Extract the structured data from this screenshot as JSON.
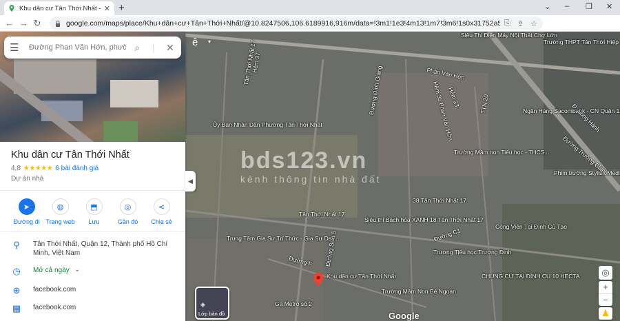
{
  "browser": {
    "tab_title": "Khu dân cư Tân Thới Nhất - Goo",
    "url": "google.com/maps/place/Khu+dân+cư+Tân+Thới+Nhất/@10.8247506,106.6189916,916m/data=!3m1!1e3!4m13!1m7!3m6!1s0x31752a580ce47c45:0x33...",
    "profile_initial": "n",
    "ext_badge": "20"
  },
  "search": {
    "placeholder": "Đường Phan Văn Hớn, phường Tân Thới Nhất"
  },
  "place": {
    "name": "Khu dân cư Tân Thới Nhất",
    "rating": "4,8",
    "stars": "★★★★★",
    "reviews": "6 bài đánh giá",
    "category": "Dự án nhà"
  },
  "actions": [
    {
      "label": "Đường đi",
      "icon": "directions-icon"
    },
    {
      "label": "Trang web",
      "icon": "globe-icon"
    },
    {
      "label": "Lưu",
      "icon": "bookmark-icon"
    },
    {
      "label": "Gần đó",
      "icon": "nearby-icon"
    },
    {
      "label": "Chia sẻ",
      "icon": "share-icon"
    }
  ],
  "info": {
    "address": "Tân Thới Nhất, Quận 12, Thành phố Hồ Chí Minh, Việt Nam",
    "hours": "Mở cả ngày",
    "website1": "facebook.com",
    "website2": "facebook.com"
  },
  "map": {
    "watermark_title": "bds123.vn",
    "watermark_sub": "kênh thông tin nhà đất",
    "layer_label": "Lớp bản đồ",
    "brand": "Google",
    "labels": [
      "Siêu Thị Điện Máy Nội Thất Chợ Lớn",
      "Trường THPT Tân Thới Hiệp",
      "Phan Văn Hớn",
      "Tân Thới Nhất 17",
      "Hẻm 37",
      "Đường Đình Giang",
      "Hẻm 35 Phan Văn Hớn",
      "Hẻm 33",
      "TTN 20",
      "Ngân Hàng Sacombank - CN Quận 12",
      "Ủy Ban Nhân Dân Phường Tân Thới Nhất",
      "Trường Mầm non Tiểu học - THCS...",
      "Phim trường Stylish Media",
      "38 Tân Thới Nhất 17",
      "Tân Thới Nhất 17",
      "Siêu thị Bách hóa XANH 18 Tân Thới Nhất 17",
      "Đường Sơn 5",
      "Trung Tâm Gia Sư Trí Thức - Gia Sư Dạy...",
      "Công Viên Tại Đình Củ Tạo",
      "Trường Tiểu học Trương Định",
      "Khu dân cư Tân Thới Nhất",
      "Trường Mầm Non Bé Ngoan",
      "CHUNG CƯ TẠI ĐÌNH CU 10 HECTA",
      "Ga Metro số 2",
      "Đường F",
      "Đường C1",
      "Đường Trường Chinh",
      "Đ. Song Hành"
    ]
  },
  "colors": {
    "accent": "#1a73e8",
    "star": "#fbbc04",
    "green": "#188038",
    "pin": "#ea4335"
  }
}
